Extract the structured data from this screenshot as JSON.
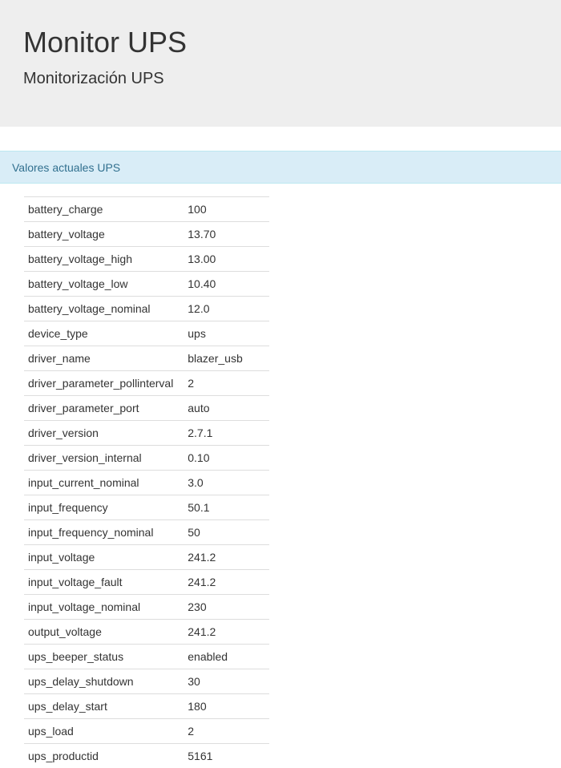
{
  "header": {
    "title": "Monitor UPS",
    "subtitle": "Monitorización UPS"
  },
  "panel": {
    "heading": "Valores actuales UPS"
  },
  "values": [
    {
      "key": "battery_charge",
      "value": "100"
    },
    {
      "key": "battery_voltage",
      "value": "13.70"
    },
    {
      "key": "battery_voltage_high",
      "value": "13.00"
    },
    {
      "key": "battery_voltage_low",
      "value": "10.40"
    },
    {
      "key": "battery_voltage_nominal",
      "value": "12.0"
    },
    {
      "key": "device_type",
      "value": "ups"
    },
    {
      "key": "driver_name",
      "value": "blazer_usb"
    },
    {
      "key": "driver_parameter_pollinterval",
      "value": "2"
    },
    {
      "key": "driver_parameter_port",
      "value": "auto"
    },
    {
      "key": "driver_version",
      "value": "2.7.1"
    },
    {
      "key": "driver_version_internal",
      "value": "0.10"
    },
    {
      "key": "input_current_nominal",
      "value": "3.0"
    },
    {
      "key": "input_frequency",
      "value": "50.1"
    },
    {
      "key": "input_frequency_nominal",
      "value": "50"
    },
    {
      "key": "input_voltage",
      "value": "241.2"
    },
    {
      "key": "input_voltage_fault",
      "value": "241.2"
    },
    {
      "key": "input_voltage_nominal",
      "value": "230"
    },
    {
      "key": "output_voltage",
      "value": "241.2"
    },
    {
      "key": "ups_beeper_status",
      "value": "enabled"
    },
    {
      "key": "ups_delay_shutdown",
      "value": "30"
    },
    {
      "key": "ups_delay_start",
      "value": "180"
    },
    {
      "key": "ups_load",
      "value": "2"
    },
    {
      "key": "ups_productid",
      "value": "5161"
    }
  ]
}
